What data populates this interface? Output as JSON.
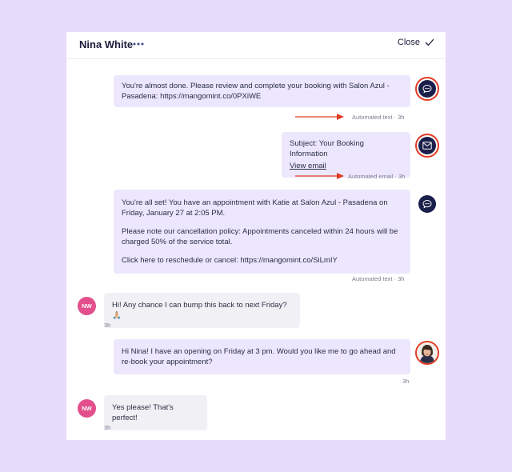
{
  "header": {
    "contact_name": "Nina White",
    "close_label": "Close"
  },
  "messages": [
    {
      "text": "You're almost done. Please review and complete your booking with Salon Azul - Pasadena: https://mangomint.co/0PXiWE",
      "meta": "Automated text · 3h",
      "icon": "chat-bubble-icon"
    },
    {
      "subject": "Subject: Your Booking Information",
      "link": "View email",
      "meta": "Automated email · 3h",
      "icon": "envelope-icon"
    },
    {
      "line1": "You're all set! You have an appointment with Katie at Salon Azul - Pasadena on Friday, January 27 at 2:05 PM.",
      "line2": "Please note our cancellation policy: Appointments canceled within 24 hours will be charged 50% of the service total.",
      "line3": "Click here to reschedule or cancel: https://mangomint.co/SiLmIY",
      "meta": "Automated text · 3h",
      "icon": "chat-bubble-icon"
    },
    {
      "initials": "NW",
      "text": "Hi! Any chance I can bump this back to next Friday? 🙏🏼",
      "meta": "3h"
    },
    {
      "text": "Hi Nina! I have an opening on Friday at 3 pm. Would you like me to go ahead and re-book your appointment?",
      "meta": "3h"
    },
    {
      "initials": "NW",
      "text": "Yes please! That's perfect!",
      "meta": "3h"
    }
  ],
  "colors": {
    "background": "#e6dcfa",
    "outgoing_bubble": "#ece7fd",
    "incoming_bubble": "#f1f1f5",
    "highlight_ring": "#e23b22",
    "avatar": "#e24f8c",
    "icon_circle": "#1a1f4a"
  }
}
